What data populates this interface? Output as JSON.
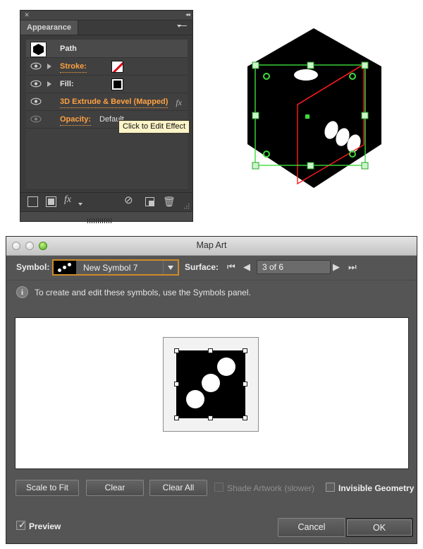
{
  "appearance_panel": {
    "tab_label": "Appearance",
    "close_icon": "close-icon",
    "collapse_icon": "collapse-panel-icon",
    "menu_icon": "panel-menu-icon",
    "path_row": {
      "label": "Path",
      "thumbnail": "black-hexagon-thumbnail"
    },
    "rows": [
      {
        "label": "Stroke:",
        "value": "",
        "swatch": "none-red-slash",
        "has_triangle": true,
        "visible": true,
        "highlight": true
      },
      {
        "label": "Fill:",
        "value": "",
        "swatch": "black",
        "has_triangle": true,
        "visible": true,
        "highlight": false
      },
      {
        "label": "3D Extrude & Bevel (Mapped)",
        "value": "",
        "swatch": "",
        "has_triangle": false,
        "visible": true,
        "highlight": true,
        "fx": "fx"
      },
      {
        "label": "Opacity:",
        "value": "Default",
        "swatch": "",
        "has_triangle": false,
        "visible": false,
        "highlight": true
      }
    ],
    "bottom_buttons": [
      {
        "name": "add-new-stroke-button",
        "icon": "square-outline-icon"
      },
      {
        "name": "add-new-fill-button",
        "icon": "square-filled-icon"
      },
      {
        "name": "add-new-effect-button",
        "icon": "fx-dropdown-icon"
      },
      {
        "name": "clear-appearance-button",
        "icon": "no-symbol-icon"
      },
      {
        "name": "duplicate-item-button",
        "icon": "duplicate-icon"
      },
      {
        "name": "delete-item-button",
        "icon": "trash-icon"
      }
    ]
  },
  "tooltip": {
    "text": "Click to Edit Effect"
  },
  "artwork": {
    "name": "3d-extruded-die-artwork",
    "description": "black hexagonal 3D die with green bounding box, selection handles and red mapped-surface outline",
    "colors": {
      "shape": "#000000",
      "selection": "#3ddb3d",
      "mapped_surface": "#ff1a1a"
    },
    "top_face_pips": 1,
    "right_face_pips": 3
  },
  "dialog": {
    "title": "Map Art",
    "window_controls": {
      "close": "close-button",
      "minimize": "minimize-button",
      "zoom": "zoom-button"
    },
    "symbol": {
      "label": "Symbol:",
      "value": "New Symbol 7",
      "thumbnail": "die-symbol-thumbnail",
      "focus_color": "#d08a2a"
    },
    "surface": {
      "label": "Surface:",
      "value": "3 of 6",
      "first_icon": "first-surface-icon",
      "prev_icon": "previous-surface-icon",
      "next_icon": "next-surface-icon",
      "last_icon": "last-surface-icon"
    },
    "info": {
      "icon": "info-icon",
      "text": "To create and edit these symbols, use the Symbols panel."
    },
    "canvas": {
      "name": "map-art-canvas",
      "symbol_preview": "black-square-with-three-white-dots",
      "handles": 8
    },
    "buttons": {
      "scale_to_fit": "Scale to Fit",
      "clear": "Clear",
      "clear_all": "Clear All",
      "cancel": "Cancel",
      "ok": "OK"
    },
    "checkboxes": {
      "shade_artwork": {
        "label": "Shade Artwork (slower)",
        "checked": false,
        "disabled": true
      },
      "invisible_geometry": {
        "label": "Invisible Geometry",
        "checked": false,
        "disabled": false
      },
      "preview": {
        "label": "Preview",
        "checked": true,
        "disabled": false
      }
    }
  }
}
